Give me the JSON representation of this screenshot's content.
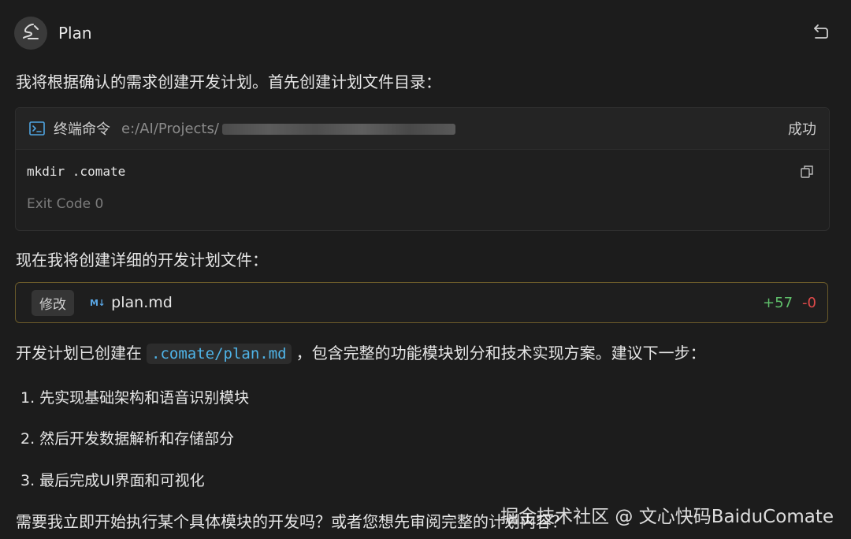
{
  "header": {
    "title": "Plan",
    "avatar_icon": "brush-icon",
    "undo_icon": "undo-icon"
  },
  "messages": {
    "intro": "我将根据确认的需求创建开发计划。首先创建计划文件目录：",
    "second": "现在我将创建详细的开发计划文件：",
    "third_before": "开发计划已创建在",
    "third_code": ".comate/plan.md",
    "third_after": "，包含完整的功能模块划分和技术实现方案。建议下一步：",
    "list": [
      "1. 先实现基础架构和语音识别模块",
      "2. 然后开发数据解析和存储部分",
      "3. 最后完成UI界面和可视化"
    ],
    "question": "需要我立即开始执行某个具体模块的开发吗？或者您想先审阅完整的计划内容？"
  },
  "terminal": {
    "title": "终端命令",
    "path": "e:/AI/Projects/",
    "status": "成功",
    "command": "mkdir .comate",
    "exit": "Exit Code 0",
    "icon": "terminal-icon",
    "copy_icon": "copy-icon"
  },
  "file_change": {
    "tag": "修改",
    "icon_text": "M↓",
    "filename": "plan.md",
    "added": "+57",
    "removed": "-0"
  },
  "watermark": "掘金技术社区 @ 文心快码BaiduComate",
  "colors": {
    "background": "#1c1c1c",
    "accent_code": "#4fb4e8",
    "added": "#5fbf6a",
    "removed": "#e04a4a",
    "file_border": "#6a5a2a"
  }
}
